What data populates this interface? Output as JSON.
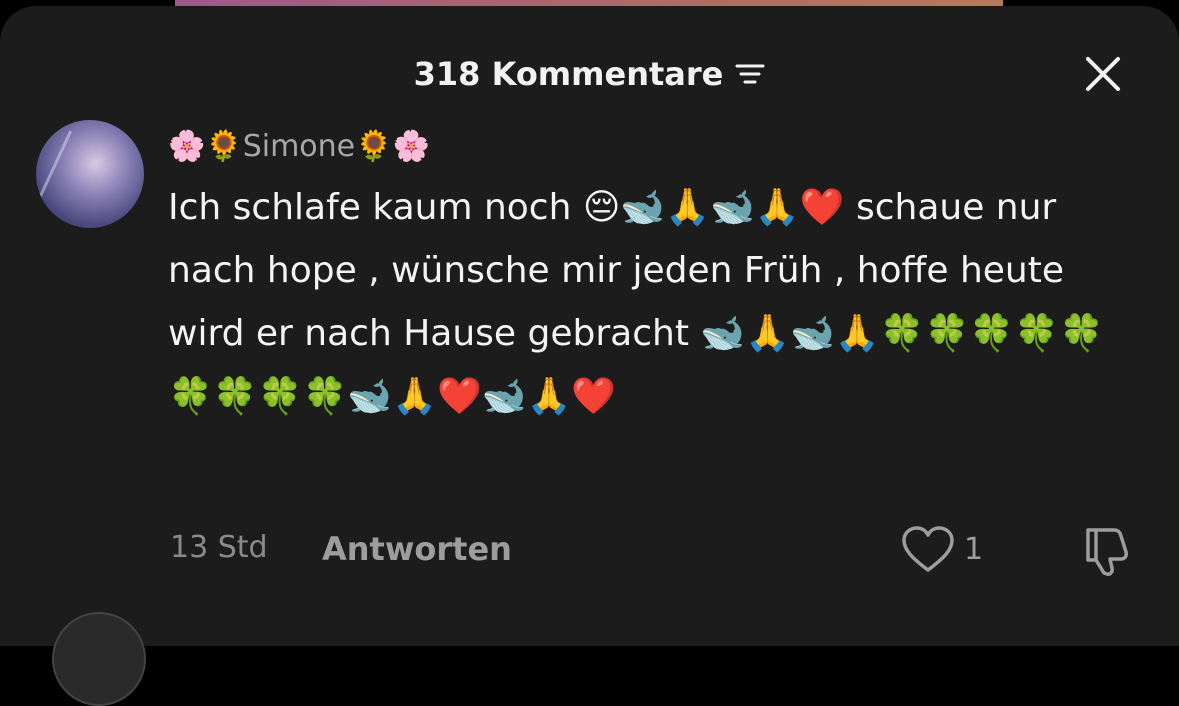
{
  "header": {
    "title": "318 Kommentare",
    "filter_icon": "filter-lines-icon",
    "close_icon": "close-x-icon"
  },
  "comment": {
    "avatar_icon": "user-avatar",
    "username": "🌸🌻Simone🌻🌸",
    "text": "Ich schlafe kaum noch 😔🐋🙏🐋🙏❤️ schaue nur nach hope , wünsche mir jeden Früh , hoffe heute wird er nach Hause gebracht 🐋🙏🐋🙏🍀🍀🍀🍀🍀🍀🍀🍀🍀🐋🙏❤️🐋🙏❤️",
    "timestamp": "13 Std",
    "reply_label": "Antworten",
    "like_count": "1",
    "like_icon": "heart-icon",
    "dislike_icon": "thumbs-down-icon"
  },
  "colors": {
    "background": "#1c1c1c",
    "primary_text": "#f4f4f4",
    "secondary_text": "#a7a7a7"
  }
}
